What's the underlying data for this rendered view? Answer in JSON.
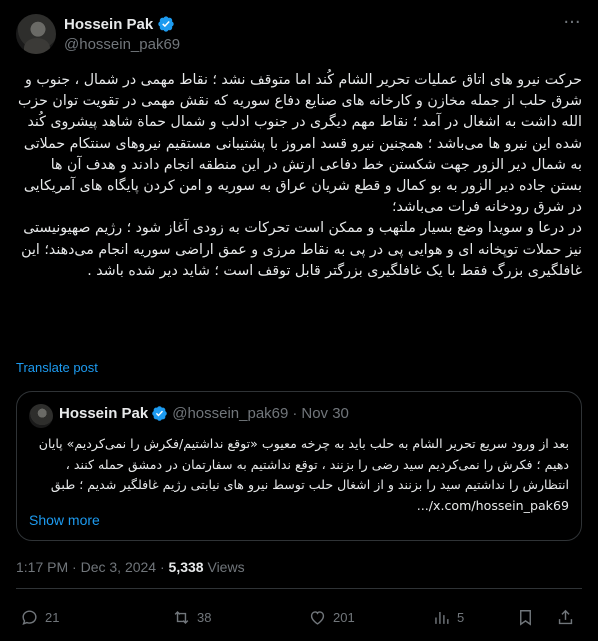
{
  "author": {
    "name": "Hossein Pak",
    "handle": "@hossein_pak69"
  },
  "post": {
    "text": "حرکت نیرو های اتاق عملیات تحریر الشام کُند اما متوقف نشد ؛ نقاط مهمی در شمال ، جنوب و شرق حلب از جمله مخازن و کارخانه های صنایع دفاع سوریه که نقش مهمی در تقویت توان حزب الله داشت به اشغال در آمد ؛ نقاط مهم دیگری در جنوب ادلب و شمال حماة شاهد پیشروی کُند شده این نیرو ها می‌باشد ؛ همچنین نیرو قسد امروز با پشتیبانی مستقیم نیروهای سنتکام حملاتی به شمال دیر الزور جهت شکستن خط دفاعی ارتش در این منطقه انجام دادند و هدف آن ها بستن جاده دیر الزور به بو کمال و قطع شریان عراق به سوریه و امن کردن پایگاه های آمریکایی در شرق رودخانه فرات می‌باشد؛\nدر درعا و سویدا وضع بسیار ملتهب و ممکن است تحرکات به زودی آغاز شود ؛ رژیم صهیونیستی نیز حملات توپخانه ای و هوایی پی در پی به نقاط مرزی و عمق اراضی سوریه انجام می‌دهند؛ این غافلگیری بزرگ فقط با یک غافلگیری بزرگتر قابل توقف است ؛ شاید دیر شده باشد .",
    "translate_label": "Translate post",
    "time": "1:17 PM",
    "date": "Dec 3, 2024",
    "separator": "·",
    "views": "5,338",
    "views_label": "Views"
  },
  "quote": {
    "name": "Hossein Pak",
    "handle": "@hossein_pak69",
    "separator": "·",
    "date": "Nov 30",
    "text": "بعد از ورود سریع تحریر الشام به حلب باید به چرخه معیوب «توقع نداشتیم/فکرش را نمی‌کردیم» پایان دهیم ؛ فکرش را نمی‌کردیم سید رضی را بزنند ، توقع نداشتیم به سفارتمان در دمشق حمله کنند ، انتظارش را نداشتیم سید را بزنند و از اشغال حلب توسط نیرو های نیابتی رژیم غافلگیر شدیم ؛ طبق x.com/hossein_pak69/...",
    "show_more": "Show more"
  },
  "actions": {
    "replies": "21",
    "reposts": "38",
    "likes": "201",
    "bookmarks": "5"
  },
  "colors": {
    "background": "#000000",
    "text": "#e7e9ea",
    "muted": "#71767b",
    "accent": "#1d9bf0",
    "border": "#2f3336"
  },
  "icons": [
    "verified-badge-icon",
    "more-options-icon",
    "reply-icon",
    "repost-icon",
    "like-icon",
    "views-chart-icon",
    "bookmark-icon",
    "share-icon"
  ]
}
